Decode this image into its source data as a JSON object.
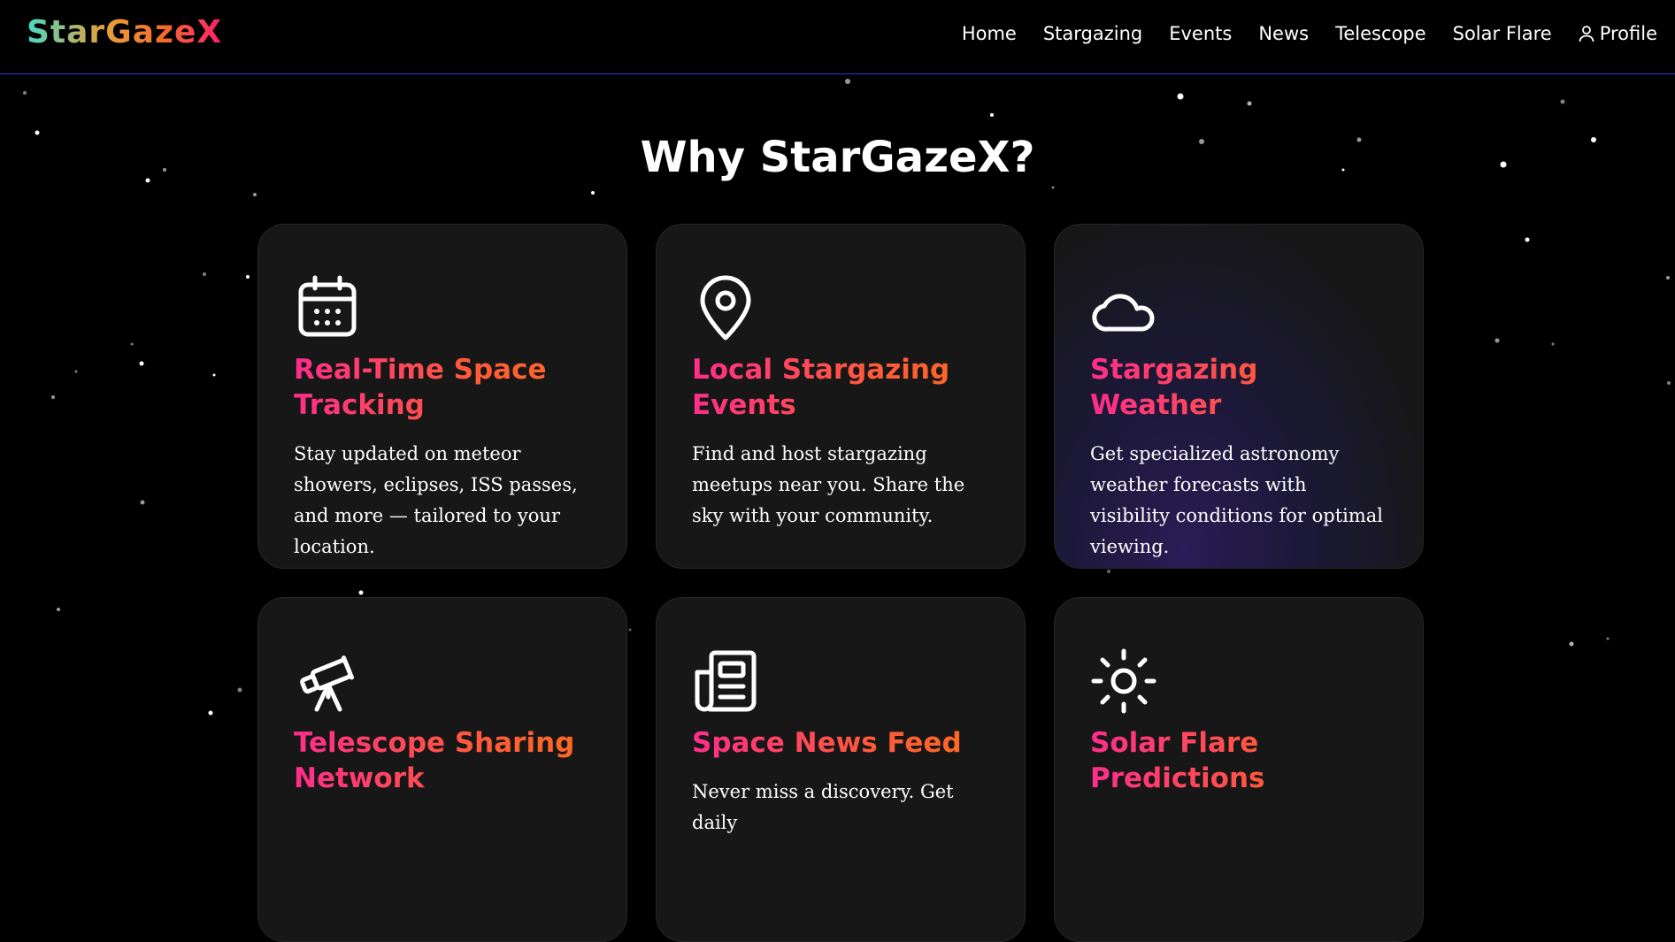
{
  "brand": {
    "logo_text": "StarGazeX"
  },
  "nav": {
    "items": [
      {
        "label": "Home"
      },
      {
        "label": "Stargazing"
      },
      {
        "label": "Events"
      },
      {
        "label": "News"
      },
      {
        "label": "Telescope"
      },
      {
        "label": "Solar Flare"
      },
      {
        "label": "Profile",
        "icon": "user-icon"
      }
    ]
  },
  "main": {
    "section_title": "Why StarGazeX?",
    "features": [
      {
        "icon": "calendar-icon",
        "title": "Real-Time Space Tracking",
        "description": "Stay updated on meteor showers, eclipses, ISS passes, and more — tailored to your location."
      },
      {
        "icon": "map-pin-icon",
        "title": "Local Stargazing Events",
        "description": "Find and host stargazing meetups near you. Share the sky with your community."
      },
      {
        "icon": "cloud-icon",
        "title": "Stargazing Weather",
        "description": "Get specialized astronomy weather forecasts with visibility conditions for optimal viewing."
      },
      {
        "icon": "telescope-icon",
        "title": "Telescope Sharing Network",
        "description": ""
      },
      {
        "icon": "newspaper-icon",
        "title": "Space News Feed",
        "description": "Never miss a discovery. Get daily"
      },
      {
        "icon": "sun-icon",
        "title": "Solar Flare Predictions",
        "description": ""
      }
    ]
  },
  "colors": {
    "background": "#000000",
    "card_background": "#171717",
    "nav_border": "#3434c8",
    "title_gradient_start": "#ff2d8c",
    "title_gradient_end": "#ff6a20"
  }
}
